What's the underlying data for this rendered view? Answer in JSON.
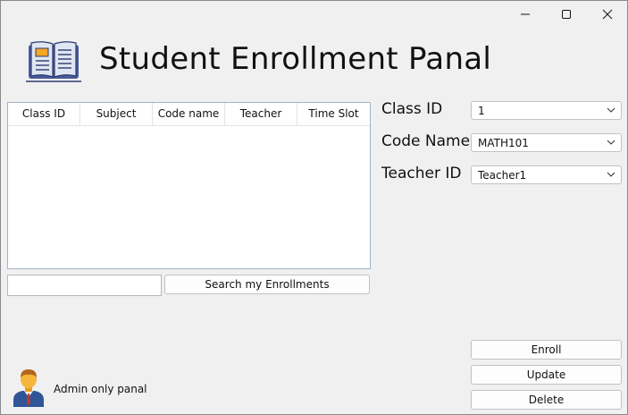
{
  "window": {
    "controls": [
      "minimize-icon",
      "maximize-icon",
      "close-icon"
    ]
  },
  "header": {
    "title": "Student Enrollment Panal",
    "logo_icon": "open-book-icon"
  },
  "enrollments_table": {
    "columns": [
      "Class ID",
      "Subject",
      "Code name",
      "Teacher",
      "Time Slot"
    ],
    "rows": []
  },
  "search": {
    "value": "",
    "button_label": "Search my Enrollments"
  },
  "form": {
    "class_id": {
      "label": "Class ID",
      "value": "1"
    },
    "code_name": {
      "label": "Code Name",
      "value": "MATH101"
    },
    "teacher_id": {
      "label": "Teacher ID",
      "value": "Teacher1"
    }
  },
  "actions": {
    "enroll_label": "Enroll",
    "update_label": "Update",
    "delete_label": "Delete"
  },
  "footer": {
    "avatar_icon": "admin-user-icon",
    "admin_label": "Admin only panal"
  },
  "colors": {
    "window_bg": "#f0f0f0",
    "table_border": "#9fb4c8",
    "book_cover": "#5b6aa8",
    "book_tag": "#f5a623",
    "avatar_skin": "#f6b63c",
    "avatar_suit": "#2f5597"
  }
}
